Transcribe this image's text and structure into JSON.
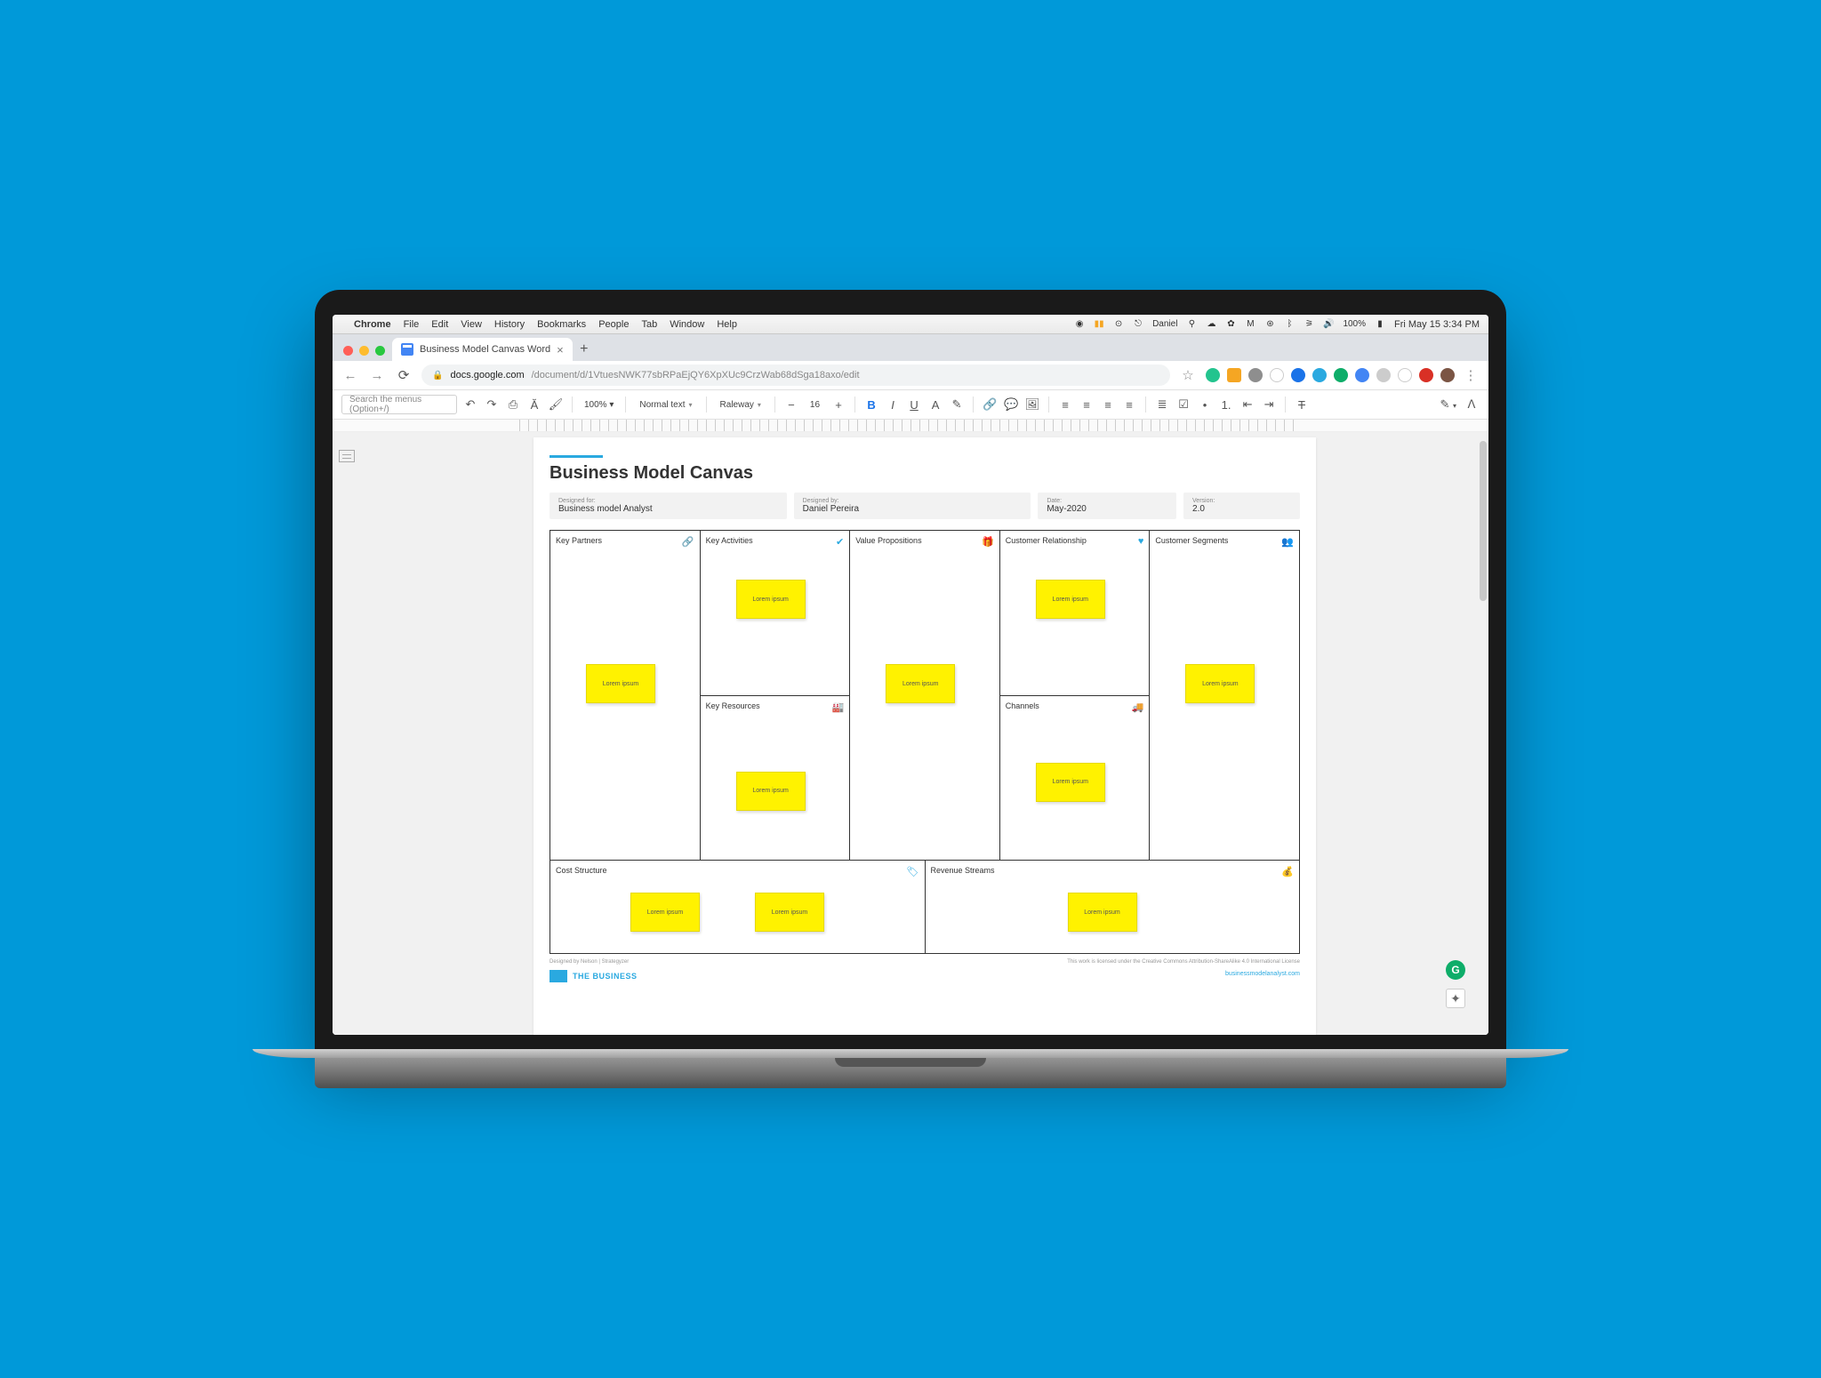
{
  "macos_menubar": {
    "app": "Chrome",
    "items": [
      "File",
      "Edit",
      "View",
      "History",
      "Bookmarks",
      "People",
      "Tab",
      "Window",
      "Help"
    ],
    "user": "Daniel",
    "battery": "100%",
    "clock": "Fri May 15  3:34 PM"
  },
  "chrome": {
    "tab_title": "Business Model Canvas Word",
    "url_domain": "docs.google.com",
    "url_path": "/document/d/1VtuesNWK77sbRPaEjQY6XpXUc9CrzWab68dSga18axo/edit"
  },
  "docs_toolbar": {
    "search_placeholder": "Search the menus (Option+/)",
    "zoom": "100%",
    "style": "Normal text",
    "font": "Raleway",
    "font_size": "16"
  },
  "document": {
    "title": "Business Model Canvas",
    "meta": {
      "designed_for_label": "Designed for:",
      "designed_for": "Business model Analyst",
      "designed_by_label": "Designed by:",
      "designed_by": "Daniel Pereira",
      "date_label": "Date:",
      "date": "May-2020",
      "version_label": "Version:",
      "version": "2.0"
    },
    "cells": {
      "key_partners": "Key Partners",
      "key_activities": "Key Activities",
      "key_resources": "Key Resources",
      "value_propositions": "Value Propositions",
      "customer_relationship": "Customer Relationship",
      "channels": "Channels",
      "customer_segments": "Customer Segments",
      "cost_structure": "Cost Structure",
      "revenue_streams": "Revenue Streams"
    },
    "sticky_text": "Lorem ipsum",
    "footer_left": "Designed by Nelson | Strategyzer",
    "footer_right_cc": "This work is licensed under the Creative Commons Attribution-ShareAlike 4.0 International License",
    "footer_link": "businessmodelanalyst.com",
    "brand": "THE BUSINESS"
  }
}
